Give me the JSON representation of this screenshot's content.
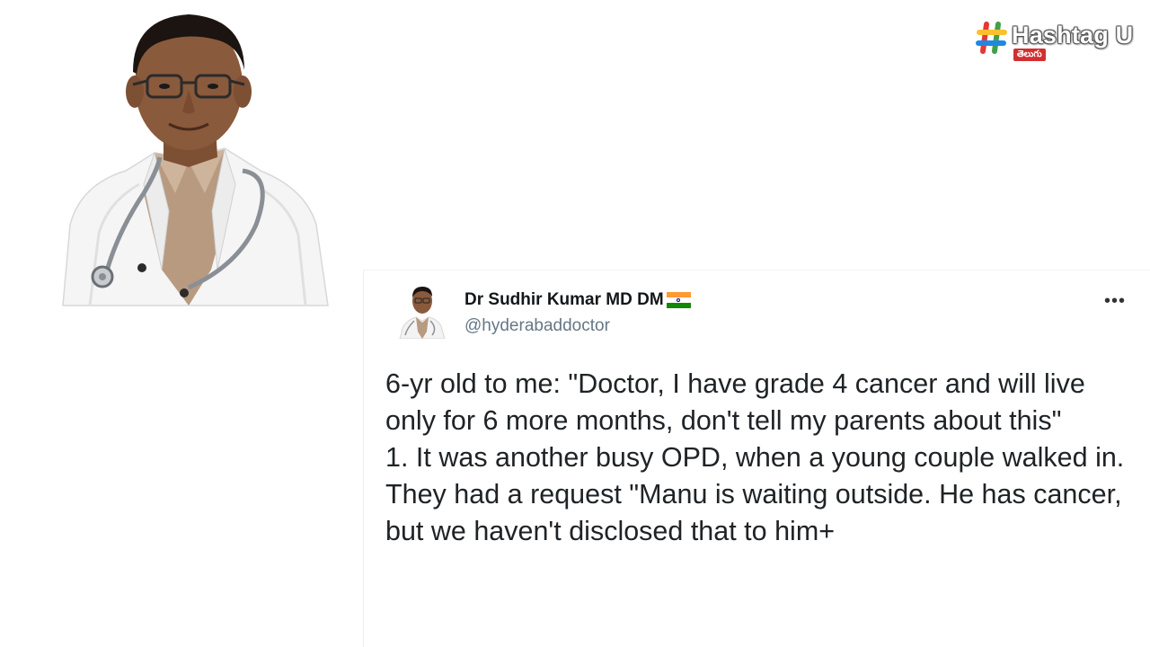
{
  "brand": {
    "name": "Hashtag U",
    "subtitle": "తెలుగు",
    "hash_symbol": "#",
    "colors": [
      "#e53935",
      "#43a047",
      "#fbc02d",
      "#1e88e5"
    ]
  },
  "photo": {
    "icon": "doctor-portrait"
  },
  "tweet": {
    "author_name": "Dr Sudhir Kumar MD DM",
    "flag_icon": "india-flag",
    "handle": "@hyderabaddoctor",
    "more_icon": "more-horizontal-icon",
    "more_label": "•••",
    "paragraphs": [
      "6-yr old to me: \"Doctor, I have grade 4 cancer and will live only for 6 more months, don't tell my parents about this\"",
      "1. It was another busy OPD, when a young couple walked in. They had a request \"Manu is waiting outside. He has cancer, but we haven't disclosed that to him+"
    ]
  },
  "colors": {
    "name_text": "#14171a",
    "handle_text": "#657786",
    "body_text": "#1f2326",
    "coat": "#f4f4f4",
    "shirt": "#b89a80",
    "skin": "#8a5a3c"
  }
}
